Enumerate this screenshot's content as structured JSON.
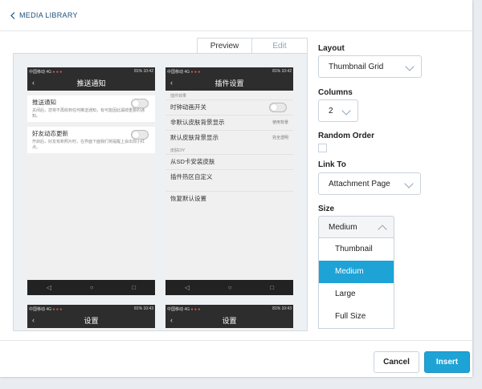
{
  "header": {
    "back_label": "MEDIA LIBRARY"
  },
  "tabs": {
    "preview": "Preview",
    "edit": "Edit"
  },
  "phones": {
    "left_top": {
      "status_left": "中国移动 4G",
      "status_right": "81% 10:42",
      "title": "推送通知",
      "rows": [
        {
          "title": "推送通知",
          "desc": "关闭后，您将不再收到任何推送通知，有可能因此漏掉重要的通知。"
        },
        {
          "title": "好友动态更新",
          "desc": "开启后，好友有新照片时，在界面下面我们将提醒上会出现小红点。"
        }
      ]
    },
    "right_top": {
      "status_left": "中国移动 4G",
      "status_right": "81% 10:42",
      "title": "插件设置",
      "section1": "插件效果",
      "item1": "时钟动画开关",
      "item2": "非默认皮肤背景显示",
      "item2_value": "使用背景",
      "item3": "默认皮肤背景显示",
      "item3_value": "完全透明",
      "section2": "皮肤DIY",
      "item4": "从SD卡安装皮肤",
      "item5": "插件热区自定义",
      "item6": "恢复默认设置"
    },
    "left_bottom": {
      "status_left": "中国移动 4G",
      "status_right": "81% 10:43",
      "title": "设置"
    },
    "right_bottom": {
      "status_left": "中国移动 4G",
      "status_right": "81% 10:43",
      "title": "设置"
    }
  },
  "settings": {
    "layout_label": "Layout",
    "layout_value": "Thumbnail Grid",
    "columns_label": "Columns",
    "columns_value": "2",
    "random_order_label": "Random Order",
    "random_order_checked": false,
    "link_to_label": "Link To",
    "link_to_value": "Attachment Page",
    "size_label": "Size",
    "size_value": "Medium",
    "size_options": [
      "Thumbnail",
      "Medium",
      "Large",
      "Full Size"
    ]
  },
  "footer": {
    "cancel": "Cancel",
    "insert": "Insert"
  },
  "colors": {
    "accent": "#1ea3d6",
    "link": "#1c4f7a"
  }
}
